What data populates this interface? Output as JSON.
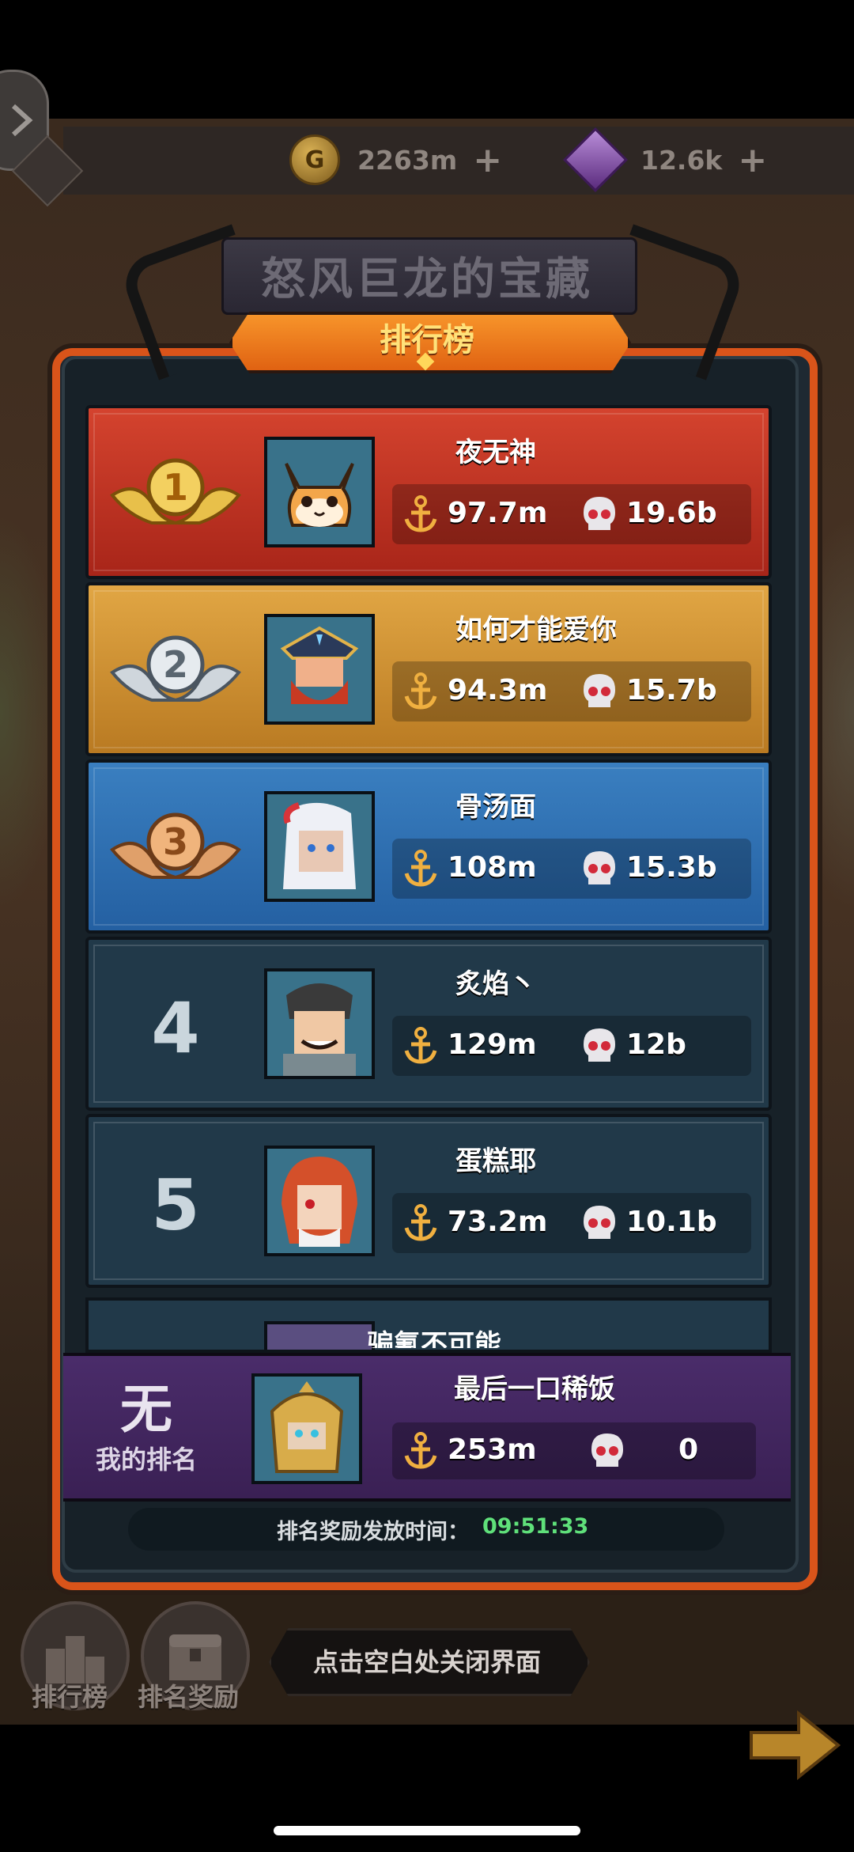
{
  "top_bar": {
    "gold_amount": "2263m",
    "gem_amount": "12.6k",
    "gold_icon_letter": "G",
    "plus_symbol": "+"
  },
  "event_title": "怒风巨龙的宝藏",
  "tab_title": "排行榜",
  "rankings": [
    {
      "rank": "1",
      "name": "夜无神",
      "power": "97.7m",
      "kills": "19.6b",
      "tier": "gold"
    },
    {
      "rank": "2",
      "name": "如何才能爱你",
      "power": "94.3m",
      "kills": "15.7b",
      "tier": "silver"
    },
    {
      "rank": "3",
      "name": "骨汤面",
      "power": "108m",
      "kills": "15.3b",
      "tier": "bronze"
    },
    {
      "rank": "4",
      "name": "炙焰丶",
      "power": "129m",
      "kills": "12b",
      "tier": "normal"
    },
    {
      "rank": "5",
      "name": "蛋糕耶",
      "power": "73.2m",
      "kills": "10.1b",
      "tier": "normal"
    }
  ],
  "partial_row": {
    "name": "骗氰不可能"
  },
  "my_rank": {
    "value": "无",
    "label": "我的排名",
    "name": "最后一口稀饭",
    "power": "253m",
    "kills": "0"
  },
  "reward_timer": {
    "label": "排名奖励发放时间：",
    "value": "09:51:33"
  },
  "bottom_nav": {
    "leaderboard_label": "排行榜",
    "rank_reward_label": "排名奖励",
    "close_hint": "点击空白处关闭界面"
  },
  "colors": {
    "accent_orange": "#d9541a",
    "timer_green": "#5fe07a",
    "gold_row": "#d4432e",
    "silver_row": "#e1a644",
    "bronze_row": "#3a7fc0",
    "normal_row": "#213949"
  },
  "icons": {
    "power": "anchor-icon",
    "kills": "skull-icon"
  }
}
